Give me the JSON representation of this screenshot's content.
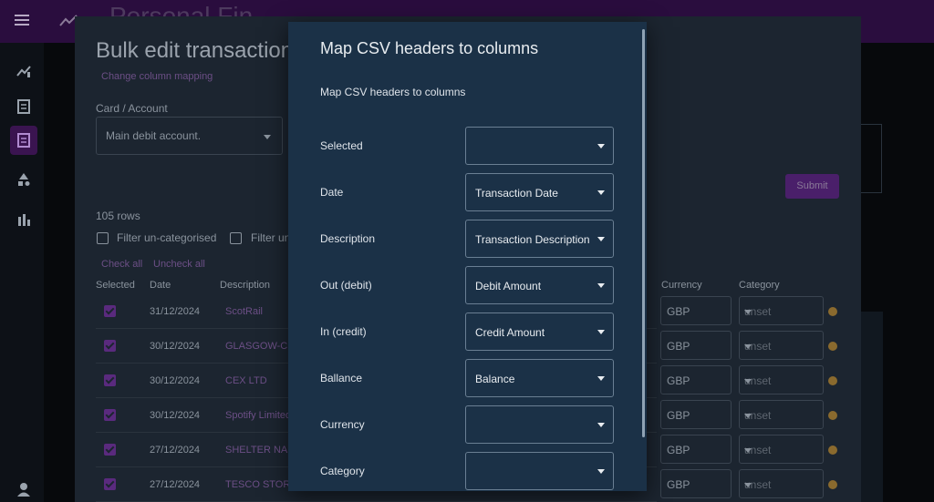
{
  "app": {
    "title": "Personal Fin"
  },
  "bulk_dialog": {
    "title": "Bulk edit transactions",
    "change_mapping_link": "Change column mapping",
    "account_label": "Card / Account",
    "account_value": "Main debit account.",
    "rows_count": "105 rows",
    "filter_uncategorised": "Filter un-categorised",
    "filter_second": "Filter un",
    "check_all": "Check all",
    "uncheck_all": "Uncheck all",
    "submit_label": "Submit",
    "columns": {
      "selected": "Selected",
      "date": "Date",
      "description": "Description",
      "currency": "Currency",
      "category": "Category"
    },
    "rows": [
      {
        "date": "31/12/2024",
        "description": "ScotRail",
        "currency": "GBP",
        "category": "unset"
      },
      {
        "date": "30/12/2024",
        "description": "GLASGOW-C",
        "currency": "GBP",
        "category": "unset"
      },
      {
        "date": "30/12/2024",
        "description": "CEX LTD",
        "currency": "GBP",
        "category": "unset"
      },
      {
        "date": "30/12/2024",
        "description": "Spotify Limited",
        "currency": "GBP",
        "category": "unset"
      },
      {
        "date": "27/12/2024",
        "description": "SHELTER NA",
        "currency": "GBP",
        "category": "unset"
      },
      {
        "date": "27/12/2024",
        "description": "TESCO STOR",
        "currency": "GBP",
        "category": "unset"
      }
    ]
  },
  "map_modal": {
    "title": "Map CSV headers to columns",
    "subtitle": "Map CSV headers to columns",
    "fields": [
      {
        "label": "Selected",
        "value": ""
      },
      {
        "label": "Date",
        "value": "Transaction Date"
      },
      {
        "label": "Description",
        "value": "Transaction Description"
      },
      {
        "label": "Out (debit)",
        "value": "Debit Amount"
      },
      {
        "label": "In (credit)",
        "value": "Credit Amount"
      },
      {
        "label": "Ballance",
        "value": "Balance"
      },
      {
        "label": "Currency",
        "value": ""
      },
      {
        "label": "Category",
        "value": ""
      }
    ]
  },
  "icons": {
    "menu": "menu-icon",
    "app": "trend-icon",
    "sidebar": [
      "dashboard-icon",
      "list-icon",
      "receipt-icon",
      "shapes-icon",
      "bar-chart-icon",
      "user-icon"
    ]
  },
  "colors": {
    "accent": "#6a2a9a",
    "modal_bg": "#1b3147",
    "topbar": "#2a0d3e"
  }
}
